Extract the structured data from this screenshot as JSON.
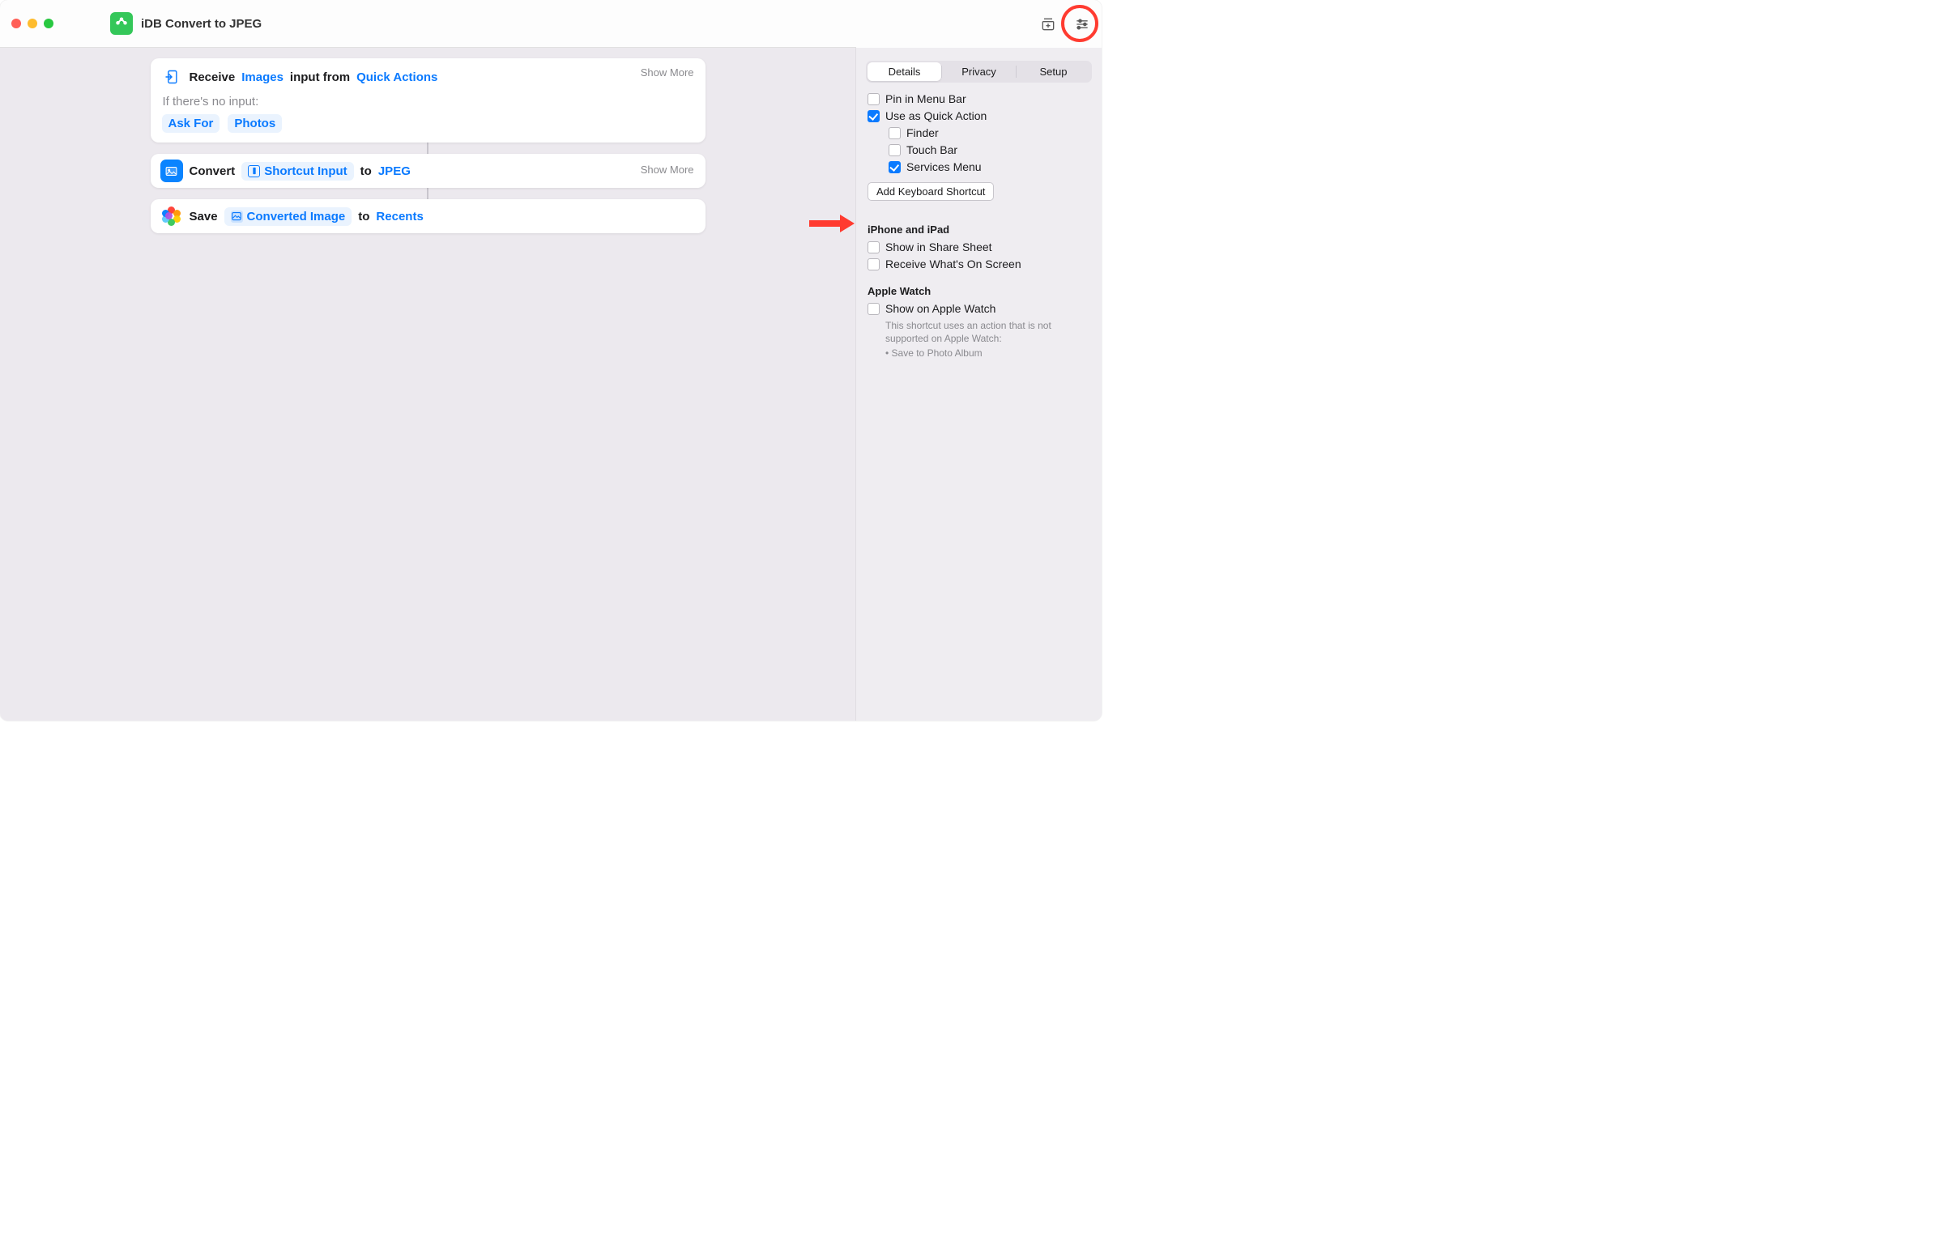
{
  "window": {
    "title": "iDB Convert to JPEG"
  },
  "toolbar": {
    "share_icon": "share-icon",
    "run_icon": "play-icon",
    "library_icon": "library-icon",
    "settings_icon": "sliders-icon"
  },
  "actions": {
    "receive": {
      "verb": "Receive",
      "type_token": "Images",
      "mid": "input from",
      "source_link": "Quick Actions",
      "show_more": "Show More",
      "no_input_label": "If there's no input:",
      "ask_for_token": "Ask For",
      "photos_token": "Photos"
    },
    "convert": {
      "verb": "Convert",
      "input_token": "Shortcut Input",
      "to": "to",
      "format_link": "JPEG",
      "show_more": "Show More"
    },
    "save": {
      "verb": "Save",
      "input_token": "Converted Image",
      "to": "to",
      "dest_link": "Recents"
    }
  },
  "inspector": {
    "tabs": {
      "details": "Details",
      "privacy": "Privacy",
      "setup": "Setup"
    },
    "checks": {
      "pin_menubar": "Pin in Menu Bar",
      "quick_action": "Use as Quick Action",
      "finder": "Finder",
      "touchbar": "Touch Bar",
      "services": "Services Menu"
    },
    "add_kbd": "Add Keyboard Shortcut",
    "section_ios": "iPhone and iPad",
    "share_sheet": "Show in Share Sheet",
    "receive_screen": "Receive What's On Screen",
    "section_watch": "Apple Watch",
    "show_watch": "Show on Apple Watch",
    "watch_note1": "This shortcut uses an action that is not supported on Apple Watch:",
    "watch_note2": "• Save to Photo Album"
  }
}
